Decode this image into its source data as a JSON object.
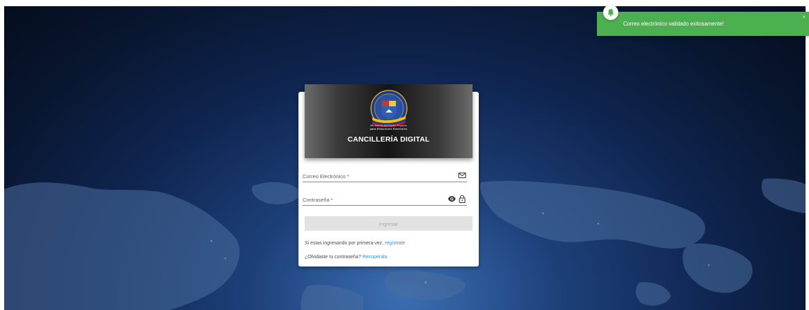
{
  "header": {
    "ministry_line1": "Ministerio del Poder Popular",
    "ministry_line2": "para Relaciones Exteriores",
    "title": "CANCILLERÍA DIGITAL"
  },
  "form": {
    "email_label": "Correo Electrónico *",
    "password_label": "Contraseña *",
    "submit_label": "Ingresar",
    "icons": {
      "email": "mail-icon",
      "visibility": "eye-icon",
      "password": "lock-icon"
    }
  },
  "links": {
    "register_text": "Si estas ingresando por primera vez,",
    "register_link": "regístrate",
    "recover_text": "¿Olvidaste tu contraseña?",
    "recover_link": "Recupérala"
  },
  "toast": {
    "message": "Correo electrónico validado exitosamente!",
    "close": "×",
    "icon": "bell-icon",
    "color": "#4caf50"
  },
  "colors": {
    "link": "#2196f3",
    "button_disabled": "#e2e2e2",
    "background_dark": "#0f2550"
  }
}
